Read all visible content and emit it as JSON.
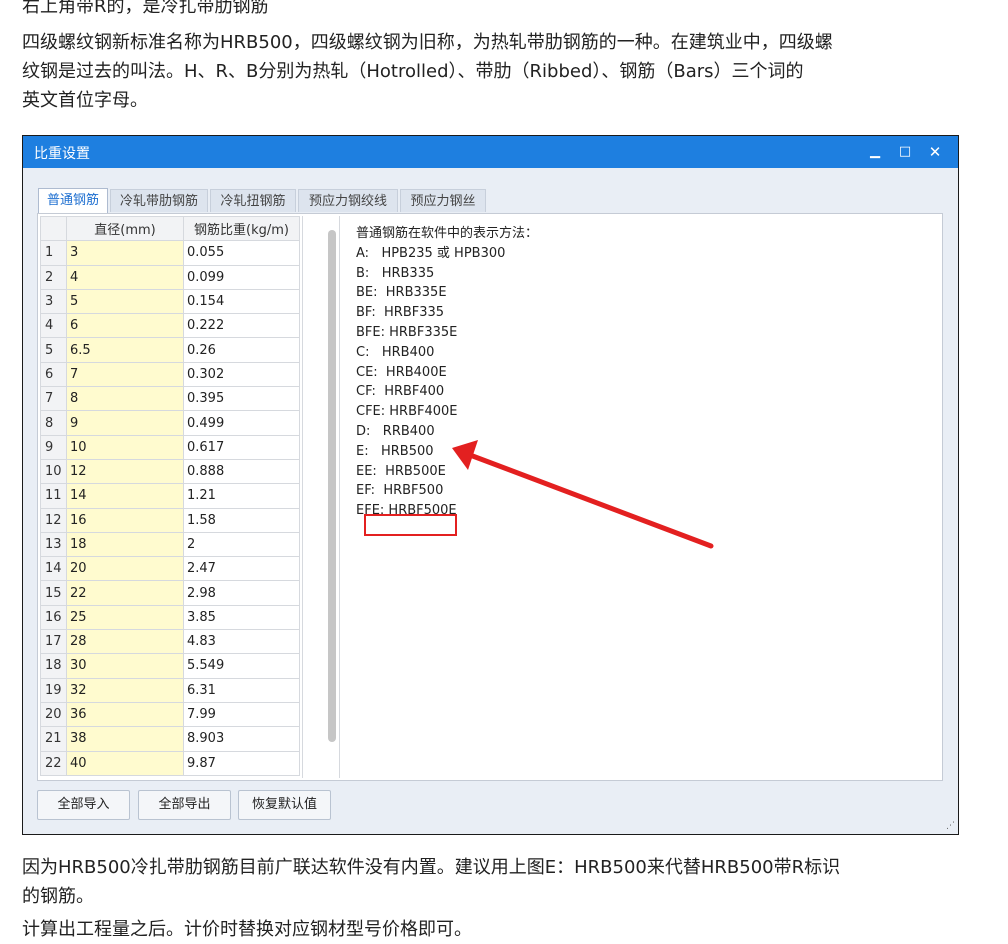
{
  "article": {
    "p1": "右上角带R的，是冷扎带肋钢筋",
    "p2": "四级螺纹钢新标准名称为HRB500，四级螺纹钢为旧称，为热轧带肋钢筋的一种。在建筑业中，四级螺",
    "p3": "纹钢是过去的叫法。H、R、B分别为热轧（Hotrolled）、带肋（Ribbed）、钢筋（Bars）三个词的",
    "p4": "英文首位字母。",
    "p5": "因为HRB500冷扎带肋钢筋目前广联达软件没有内置。建议用上图E：HRB500来代替HRB500带R标识",
    "p6": "的钢筋。",
    "p7": "计算出工程量之后。计价时替换对应钢材型号价格即可。"
  },
  "window": {
    "title": "比重设置",
    "min_glyph": "▁",
    "max_glyph": "□",
    "close_glyph": "✕"
  },
  "tabs": [
    "普通钢筋",
    "冷轧带肋钢筋",
    "冷轧扭钢筋",
    "预应力钢绞线",
    "预应力钢丝"
  ],
  "table": {
    "col_diameter": "直径(mm)",
    "col_weight": "钢筋比重(kg/m)",
    "rows": [
      [
        "1",
        "3",
        "0.055"
      ],
      [
        "2",
        "4",
        "0.099"
      ],
      [
        "3",
        "5",
        "0.154"
      ],
      [
        "4",
        "6",
        "0.222"
      ],
      [
        "5",
        "6.5",
        "0.26"
      ],
      [
        "6",
        "7",
        "0.302"
      ],
      [
        "7",
        "8",
        "0.395"
      ],
      [
        "8",
        "9",
        "0.499"
      ],
      [
        "9",
        "10",
        "0.617"
      ],
      [
        "10",
        "12",
        "0.888"
      ],
      [
        "11",
        "14",
        "1.21"
      ],
      [
        "12",
        "16",
        "1.58"
      ],
      [
        "13",
        "18",
        "2"
      ],
      [
        "14",
        "20",
        "2.47"
      ],
      [
        "15",
        "22",
        "2.98"
      ],
      [
        "16",
        "25",
        "3.85"
      ],
      [
        "17",
        "28",
        "4.83"
      ],
      [
        "18",
        "30",
        "5.549"
      ],
      [
        "19",
        "32",
        "6.31"
      ],
      [
        "20",
        "36",
        "7.99"
      ],
      [
        "21",
        "38",
        "8.903"
      ],
      [
        "22",
        "40",
        "9.87"
      ]
    ]
  },
  "info": {
    "heading": "普通钢筋在软件中的表示方法：",
    "lines": [
      "A:   HPB235 或 HPB300",
      "B:   HRB335",
      "BE:  HRB335E",
      "BF:  HRBF335",
      "BFE: HRBF335E",
      "C:   HRB400",
      "CE:  HRB400E",
      "CF:  HRBF400",
      "CFE: HRBF400E",
      "D:   RRB400",
      "E:   HRB500",
      "EE:  HRB500E",
      "EF:  HRBF500",
      "EFE: HRBF500E"
    ]
  },
  "buttons": {
    "import_all": "全部导入",
    "export_all": "全部导出",
    "restore_default": "恢复默认值"
  },
  "annotation": {
    "color": "#e32020"
  }
}
